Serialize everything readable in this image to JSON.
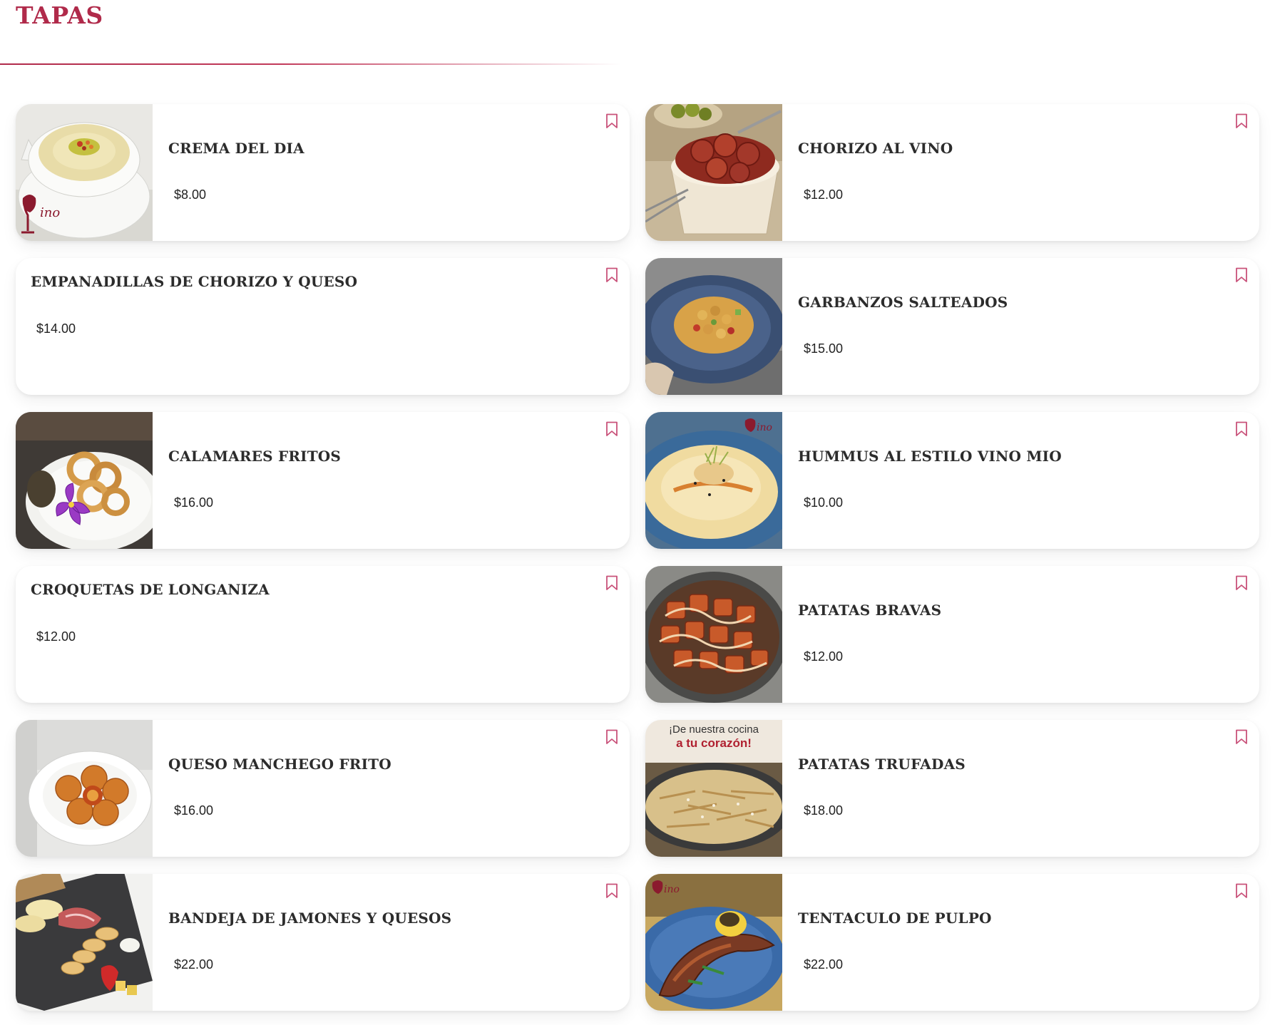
{
  "section": {
    "title": "TAPAS"
  },
  "theme": {
    "accent": "#b02a4a",
    "bookmark_color": "#c9527a"
  },
  "items": [
    {
      "name": "CREMA DEL DIA",
      "price": "$8.00",
      "has_image": true,
      "image": "cream-soup-photo"
    },
    {
      "name": "CHORIZO AL VINO",
      "price": "$12.00",
      "has_image": true,
      "image": "chorizo-bowl-photo"
    },
    {
      "name": "EMPANADILLAS DE CHORIZO Y QUESO",
      "price": "$14.00",
      "has_image": false
    },
    {
      "name": "GARBANZOS SALTEADOS",
      "price": "$15.00",
      "has_image": true,
      "image": "chickpeas-plate-photo"
    },
    {
      "name": "CALAMARES FRITOS",
      "price": "$16.00",
      "has_image": true,
      "image": "fried-calamari-photo"
    },
    {
      "name": "HUMMUS AL ESTILO VINO MIO",
      "price": "$10.00",
      "has_image": true,
      "image": "hummus-plate-photo"
    },
    {
      "name": "CROQUETAS DE LONGANIZA",
      "price": "$12.00",
      "has_image": false
    },
    {
      "name": "PATATAS BRAVAS",
      "price": "$12.00",
      "has_image": true,
      "image": "patatas-bravas-photo"
    },
    {
      "name": "QUESO MANCHEGO FRITO",
      "price": "$16.00",
      "has_image": true,
      "image": "fried-cheese-balls-photo"
    },
    {
      "name": "PATATAS TRUFADAS",
      "price": "$18.00",
      "has_image": true,
      "image": "truffle-fries-photo",
      "image_text": [
        "¡De nuestra cocina",
        "a tu corazón!"
      ]
    },
    {
      "name": "BANDEJA DE JAMONES Y QUESOS",
      "price": "$22.00",
      "has_image": true,
      "image": "ham-cheese-board-photo"
    },
    {
      "name": "TENTACULO DE PULPO",
      "price": "$22.00",
      "has_image": true,
      "image": "octopus-tentacle-photo"
    }
  ]
}
